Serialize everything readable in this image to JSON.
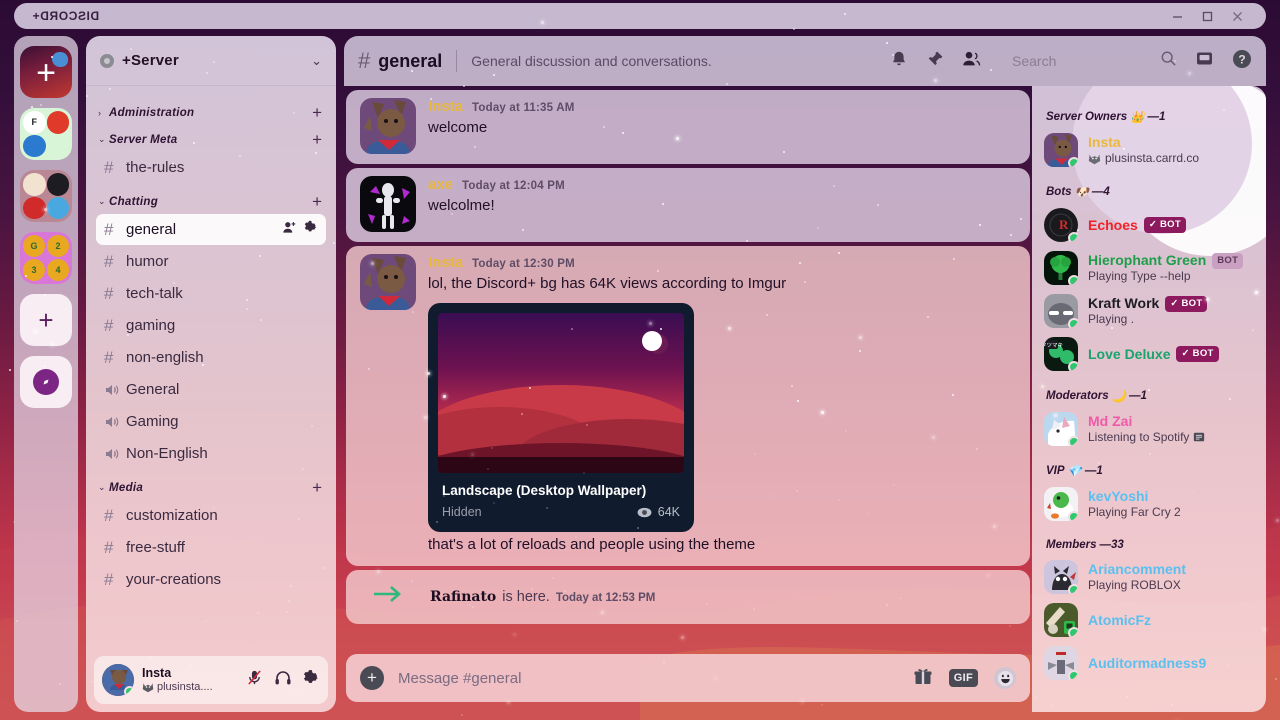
{
  "window": {
    "title": "DISCORD+",
    "controls": [
      {
        "name": "minimize",
        "glyph": "—"
      },
      {
        "name": "maximize",
        "glyph": "□"
      },
      {
        "name": "close",
        "glyph": "✕"
      }
    ]
  },
  "rail": {
    "guilds": [
      {
        "name": "discord-plus-home",
        "label": "+",
        "selected": true
      },
      {
        "name": "mario-server",
        "label": ""
      },
      {
        "name": "friends-server",
        "label": ""
      },
      {
        "name": "coins-server",
        "label": ""
      },
      {
        "name": "add-server",
        "label": "+"
      },
      {
        "name": "explore-servers",
        "label": ""
      }
    ]
  },
  "sidebar": {
    "server_name": "+Server",
    "categories": [
      {
        "label": "Administration",
        "collapsed": true,
        "channels": []
      },
      {
        "label": "Server Meta",
        "collapsed": false,
        "channels": [
          {
            "name": "the-rules",
            "type": "text",
            "active": false
          }
        ]
      },
      {
        "label": "Chatting",
        "collapsed": false,
        "channels": [
          {
            "name": "general",
            "type": "text",
            "active": true
          },
          {
            "name": "humor",
            "type": "text",
            "active": false
          },
          {
            "name": "tech-talk",
            "type": "text",
            "active": false
          },
          {
            "name": "gaming",
            "type": "text",
            "active": false
          },
          {
            "name": "non-english",
            "type": "text",
            "active": false
          },
          {
            "name": "General",
            "type": "voice",
            "active": false
          },
          {
            "name": "Gaming",
            "type": "voice",
            "active": false
          },
          {
            "name": "Non-English",
            "type": "voice",
            "active": false
          }
        ]
      },
      {
        "label": "Media",
        "collapsed": false,
        "channels": [
          {
            "name": "customization",
            "type": "text",
            "active": false
          },
          {
            "name": "free-stuff",
            "type": "text",
            "active": false
          },
          {
            "name": "your-creations",
            "type": "text",
            "active": false
          }
        ]
      }
    ],
    "user": {
      "name": "Insta",
      "status_text": "plusinsta....",
      "presence": "online"
    }
  },
  "chat": {
    "channel_name": "general",
    "topic": "General discussion and conversations.",
    "search_placeholder": "Search",
    "messages": [
      {
        "author": "Insta",
        "author_color": "#e8b83c",
        "time": "Today at 11:35 AM",
        "text": "welcome",
        "tone": "cool"
      },
      {
        "author": "axe",
        "author_color": "#e8b83c",
        "time": "Today at 12:04 PM",
        "text": "welcolme!",
        "tone": "cool"
      },
      {
        "author": "Insta",
        "author_color": "#e8b83c",
        "time": "Today at 12:30 PM",
        "text": "lol, the Discord+ bg has 64K views according to Imgur",
        "text_after": "that's a lot of reloads and people using the theme",
        "tone": "warm",
        "embed": {
          "title": "Landscape (Desktop Wallpaper)",
          "hidden_label": "Hidden",
          "views": "64K"
        }
      }
    ],
    "join_event": {
      "user": "Rafinato",
      "action": "is here.",
      "time": "Today at 12:53 PM"
    },
    "composer": {
      "placeholder": "Message #general",
      "gif_label": "GIF"
    }
  },
  "members": {
    "sections": [
      {
        "label": "Server Owners",
        "emoji": "👑",
        "count": "1",
        "people": [
          {
            "name": "Insta",
            "color": "#e8b83c",
            "status": "plusinsta.carrd.co",
            "status_icon": "wolf",
            "badge": "",
            "avatar": "insta"
          }
        ]
      },
      {
        "label": "Bots",
        "emoji": "🐶",
        "count": "4",
        "people": [
          {
            "name": "Echoes",
            "color": "#f0232a",
            "status": "",
            "badge": "✓ BOT",
            "badge_style": "dark",
            "avatar": "echoes"
          },
          {
            "name": "Hierophant Green",
            "color": "#1e9e4a",
            "status": "Playing Type --help",
            "status_bold": "Type --help",
            "badge": "BOT",
            "badge_style": "light",
            "avatar": "hierophant"
          },
          {
            "name": "Kraft Work",
            "color": "#1c1c22",
            "status": "Playing .",
            "status_bold": ".",
            "badge": "✓ BOT",
            "badge_style": "dark",
            "avatar": "kraft"
          },
          {
            "name": "Love Deluxe",
            "color": "#19a36e",
            "status": "",
            "badge": "✓ BOT",
            "badge_style": "dark",
            "avatar": "love"
          }
        ]
      },
      {
        "label": "Moderators",
        "emoji": "🌙",
        "count": "1",
        "people": [
          {
            "name": "Md Zai",
            "color": "#ef5aa8",
            "status": "Listening to Spotify",
            "status_bold": "Spotify",
            "badge": "",
            "avatar": "mdzai"
          }
        ]
      },
      {
        "label": "VIP",
        "emoji": "💎",
        "count": "1",
        "people": [
          {
            "name": "kevYoshi",
            "color": "#5bc0f0",
            "status": "Playing Far Cry 2",
            "status_bold": "Far Cry 2",
            "badge": "",
            "avatar": "yoshi"
          }
        ]
      },
      {
        "label": "Members",
        "emoji": "",
        "count": "33",
        "people": [
          {
            "name": "Ariancomment",
            "color": "#5bc0f0",
            "status": "Playing ROBLOX",
            "status_bold": "ROBLOX",
            "badge": "",
            "avatar": "arian"
          },
          {
            "name": "AtomicFz",
            "color": "#5bc0f0",
            "status": "",
            "badge": "",
            "avatar": "atomic"
          },
          {
            "name": "Auditormadness9",
            "color": "#5bc0f0",
            "status": "",
            "badge": "",
            "avatar": "auditor"
          }
        ]
      }
    ]
  },
  "colors": {
    "accent_purple": "#2b0b33",
    "accent_red": "#c7394b",
    "online_green": "#2fc86f",
    "bot_badge": "#8d1a5e"
  }
}
